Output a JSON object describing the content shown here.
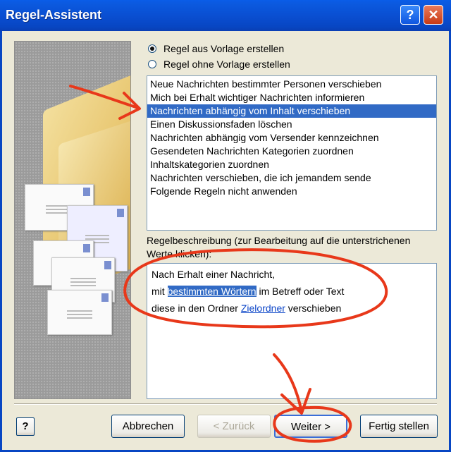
{
  "window": {
    "title": "Regel-Assistent",
    "help_glyph": "?",
    "close_glyph": "✕"
  },
  "options": {
    "from_template": "Regel aus Vorlage erstellen",
    "blank": "Regel ohne Vorlage erstellen"
  },
  "templates": [
    "Neue Nachrichten bestimmter Personen verschieben",
    "Mich bei Erhalt wichtiger Nachrichten informieren",
    "Nachrichten abhängig vom Inhalt verschieben",
    "Einen Diskussionsfaden löschen",
    "Nachrichten abhängig vom Versender kennzeichnen",
    "Gesendeten Nachrichten Kategorien zuordnen",
    "Inhaltskategorien zuordnen",
    "Nachrichten verschieben, die ich jemandem sende",
    "Folgende Regeln nicht anwenden"
  ],
  "selected_index": 2,
  "description": {
    "label": "Regelbeschreibung (zur Bearbeitung auf die unterstrichenen Werte klicken):",
    "line1": "Nach Erhalt einer Nachricht,",
    "line2_pre": "mit ",
    "line2_link": "bestimmten Wörtern",
    "line2_post": " im Betreff oder Text",
    "line3_pre": "diese in den Ordner ",
    "line3_link": "Zielordner",
    "line3_post": " verschieben"
  },
  "buttons": {
    "help": "?",
    "cancel": "Abbrechen",
    "back": "< Zurück",
    "next": "Weiter >",
    "finish": "Fertig stellen"
  },
  "colors": {
    "title_bar": "#0a4fd2",
    "selection": "#316ac5",
    "annotation": "#e8381a",
    "link": "#0b45c8"
  }
}
